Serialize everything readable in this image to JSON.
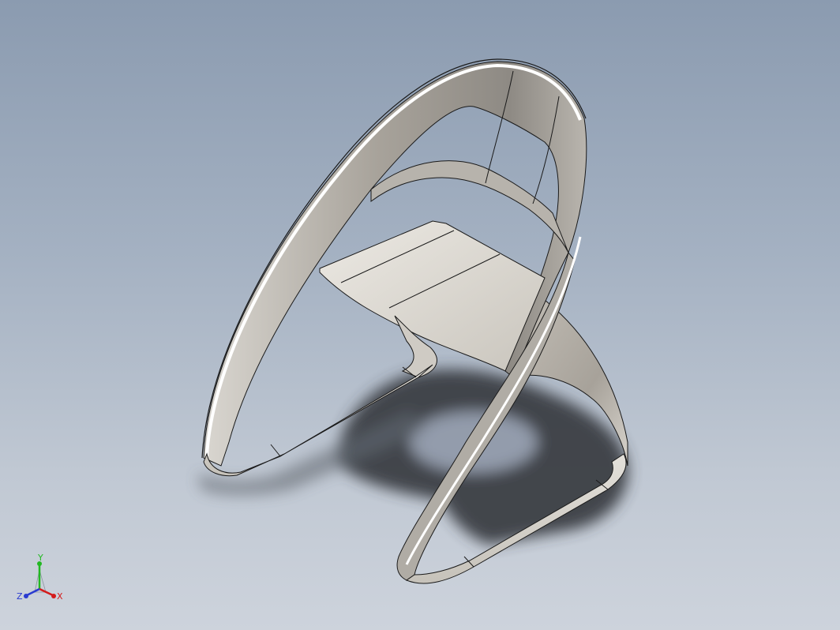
{
  "viewport": {
    "background_top": "#8b9bb0",
    "background_bottom": "#cdd3dc",
    "model_surface_color": "#a9a59f",
    "model_edge_color": "#1a1a1a",
    "shadow_color": "#3a3d44"
  },
  "triad": {
    "x_label": "X",
    "y_label": "Y",
    "z_label": "Z",
    "x_color": "#d41c1c",
    "y_color": "#22b822",
    "z_color": "#2a3bd0"
  }
}
